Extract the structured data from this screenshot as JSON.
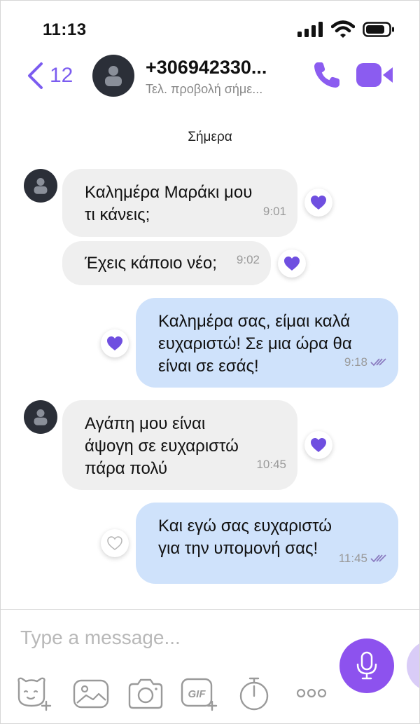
{
  "status_bar": {
    "time": "11:13"
  },
  "header": {
    "back_count": "12",
    "contact_name": "+306942330...",
    "contact_subtitle": "Τελ. προβολή σήμε..."
  },
  "date_separator": "Σήμερα",
  "messages": [
    {
      "direction": "incoming",
      "text": "Καλημέρα Μαράκι μου\nτι κάνεις;",
      "time": "9:01",
      "liked": true
    },
    {
      "direction": "incoming",
      "text": "Έχεις κάποιο νέο;",
      "time": "9:02",
      "liked": true
    },
    {
      "direction": "outgoing",
      "text": "Καλημέρα σας, είμαι καλά\nευχαριστώ! Σε μια ώρα θα\nείναι σε εσάς!",
      "time": "9:18",
      "liked": true,
      "status": "read"
    },
    {
      "direction": "incoming",
      "text": "Αγάπη μου είναι\nάψογη σε ευχαριστώ\nπάρα πολύ",
      "time": "10:45",
      "liked": true
    },
    {
      "direction": "outgoing",
      "text": "Και εγώ σας ευχαριστώ\nγια την υπομονή σας!",
      "time": "11:45",
      "liked": false,
      "status": "read"
    }
  ],
  "composer": {
    "placeholder": "Type a message...",
    "gif_label": "GIF",
    "tools": [
      "sticker-add-icon",
      "gallery-icon",
      "camera-icon",
      "gif-add-icon",
      "timer-icon",
      "more-icon"
    ]
  },
  "colors": {
    "accent": "#7b5cf0",
    "mic": "#8d52ee",
    "incoming_bubble": "#efefef",
    "outgoing_bubble": "#cfe2fb",
    "heart": "#6f4fe0"
  }
}
